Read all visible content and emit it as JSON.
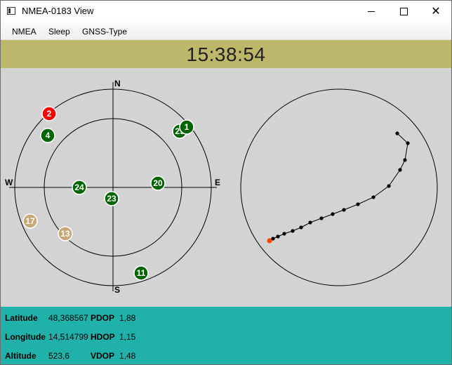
{
  "window": {
    "title": "NMEA-0183 View",
    "icon": "app-window-icon"
  },
  "menu": [
    "NMEA",
    "Sleep",
    "GNSS-Type"
  ],
  "clock": "15:38:54",
  "skyplot": {
    "compass": {
      "north": "N",
      "south": "S",
      "east": "E",
      "west": "W"
    },
    "colors": {
      "background": "#d3d3d3",
      "in_use": "#006400",
      "not_in_use": "#c8a878",
      "highlighted": "#ff0000"
    },
    "satellites": [
      {
        "prn": "2",
        "state": "highlighted"
      },
      {
        "prn": "4",
        "state": "in_use"
      },
      {
        "prn": "1",
        "state": "in_use"
      },
      {
        "prn": "29",
        "state": "in_use"
      },
      {
        "prn": "24",
        "state": "in_use"
      },
      {
        "prn": "20",
        "state": "in_use"
      },
      {
        "prn": "23",
        "state": "in_use"
      },
      {
        "prn": "17",
        "state": "not_in_use"
      },
      {
        "prn": "13",
        "state": "not_in_use"
      },
      {
        "prn": "11",
        "state": "in_use"
      }
    ]
  },
  "track": {
    "colors": {
      "line": "#000000",
      "current": "#ff4500"
    }
  },
  "info": {
    "latitude": {
      "label": "Latitude",
      "value": "48,368567"
    },
    "longitude": {
      "label": "Longitude",
      "value": "14,514799"
    },
    "altitude": {
      "label": "Altitude",
      "value": "523,6"
    },
    "pdop": {
      "label": "PDOP",
      "value": "1,88"
    },
    "hdop": {
      "label": "HDOP",
      "value": "1,15"
    },
    "vdop": {
      "label": "VDOP",
      "value": "1,48"
    },
    "background": "#20b2aa"
  }
}
